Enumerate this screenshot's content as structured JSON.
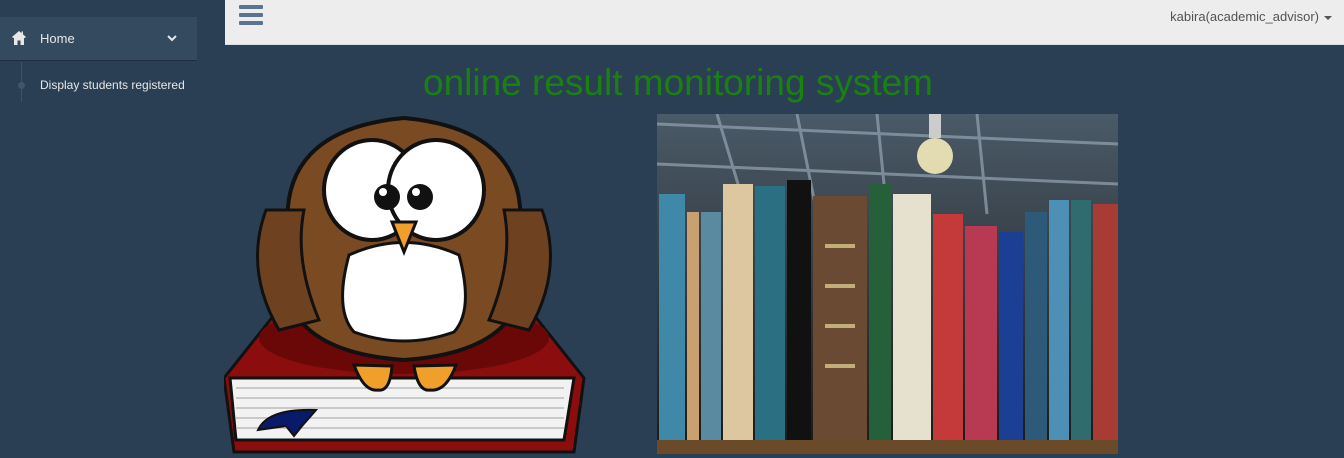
{
  "sidebar": {
    "home_label": "Home",
    "submenu": [
      "Display students registered"
    ]
  },
  "topbar": {
    "user_label": "kabira(academic_advisor)"
  },
  "main": {
    "title": "online result monitoring system"
  }
}
